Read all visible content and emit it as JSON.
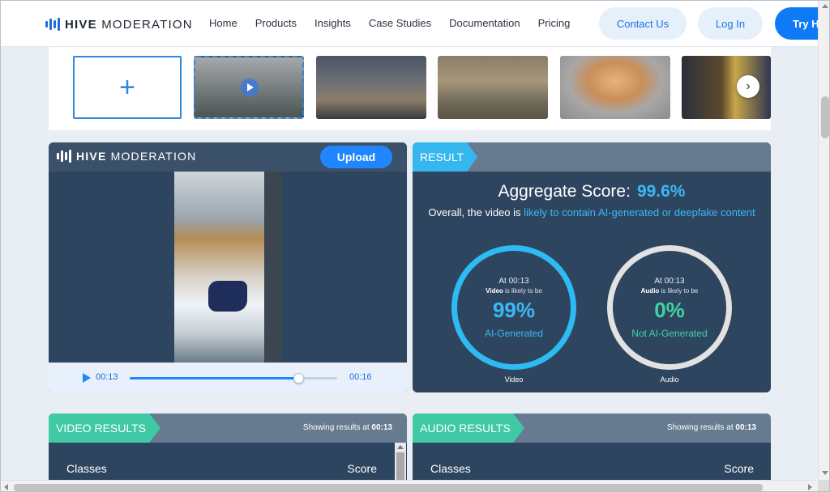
{
  "header": {
    "logo_bold": "HIVE",
    "logo_light": "MODERATION",
    "nav": [
      "Home",
      "Products",
      "Insights",
      "Case Studies",
      "Documentation",
      "Pricing"
    ],
    "contact_label": "Contact Us",
    "login_label": "Log In",
    "try_label": "Try H"
  },
  "thumbstrip": {
    "add_label": "+",
    "next_label": "›"
  },
  "player": {
    "logo_bold": "HIVE",
    "logo_light": "MODERATION",
    "upload_label": "Upload",
    "current_time": "00:13",
    "duration": "00:16",
    "progress": 0.8125
  },
  "result": {
    "tag": "RESULT",
    "aggregate_label": "Aggregate Score:",
    "aggregate_value": "99.6%",
    "summary_prefix": "Overall, the video is",
    "summary_highlight": "likely to contain AI-generated or deepfake content",
    "video": {
      "at": "At 00:13",
      "subject": "Video",
      "likely": "is likely to be",
      "pct": "99%",
      "label": "AI-Generated",
      "caption": "Video"
    },
    "audio": {
      "at": "At 00:13",
      "subject": "Audio",
      "likely": "is likely to be",
      "pct": "0%",
      "label": "Not AI-Generated",
      "caption": "Audio"
    }
  },
  "video_results": {
    "tag": "VIDEO RESULTS",
    "showing_prefix": "Showing results at",
    "showing_time": "00:13",
    "col_classes": "Classes",
    "col_score": "Score"
  },
  "audio_results": {
    "tag": "AUDIO RESULTS",
    "showing_prefix": "Showing results at",
    "showing_time": "00:13",
    "col_classes": "Classes",
    "col_score": "Score"
  },
  "colors": {
    "accent": "#1f86ff",
    "result_blue": "#36b6ee",
    "green": "#3fc9a4",
    "panel": "#2e4560"
  }
}
